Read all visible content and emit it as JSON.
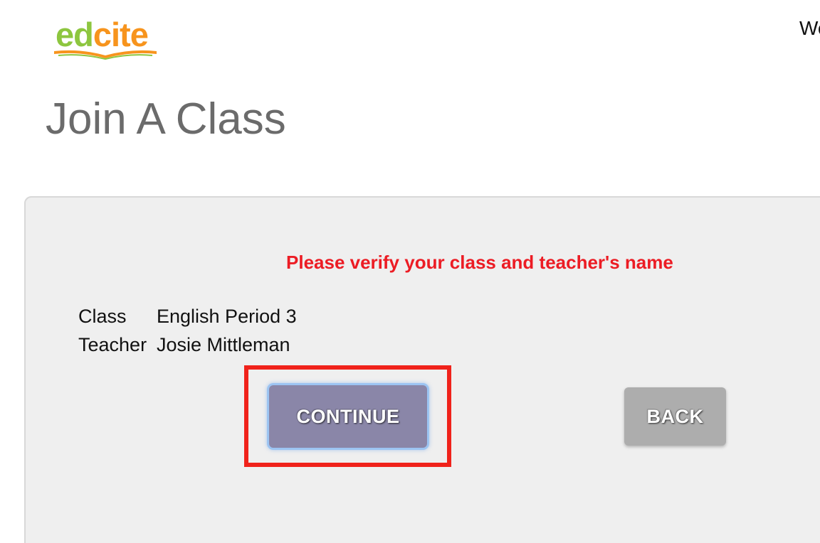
{
  "header": {
    "logo": {
      "part1": "ed",
      "part2": "cite",
      "part1_color": "#8dc63f",
      "part2_color": "#f7941d",
      "icon": "open-book-icon"
    },
    "welcome_text": "We"
  },
  "page": {
    "title": "Join A Class"
  },
  "panel": {
    "message": "Please verify your class and teacher's name",
    "message_color": "#ec1c24",
    "class_label": "Class",
    "class_value": "English Period 3",
    "teacher_label": "Teacher",
    "teacher_value": "Josie Mittleman"
  },
  "actions": {
    "continue_label": "CONTINUE",
    "back_label": "BACK",
    "highlight_color": "#f0221b"
  }
}
